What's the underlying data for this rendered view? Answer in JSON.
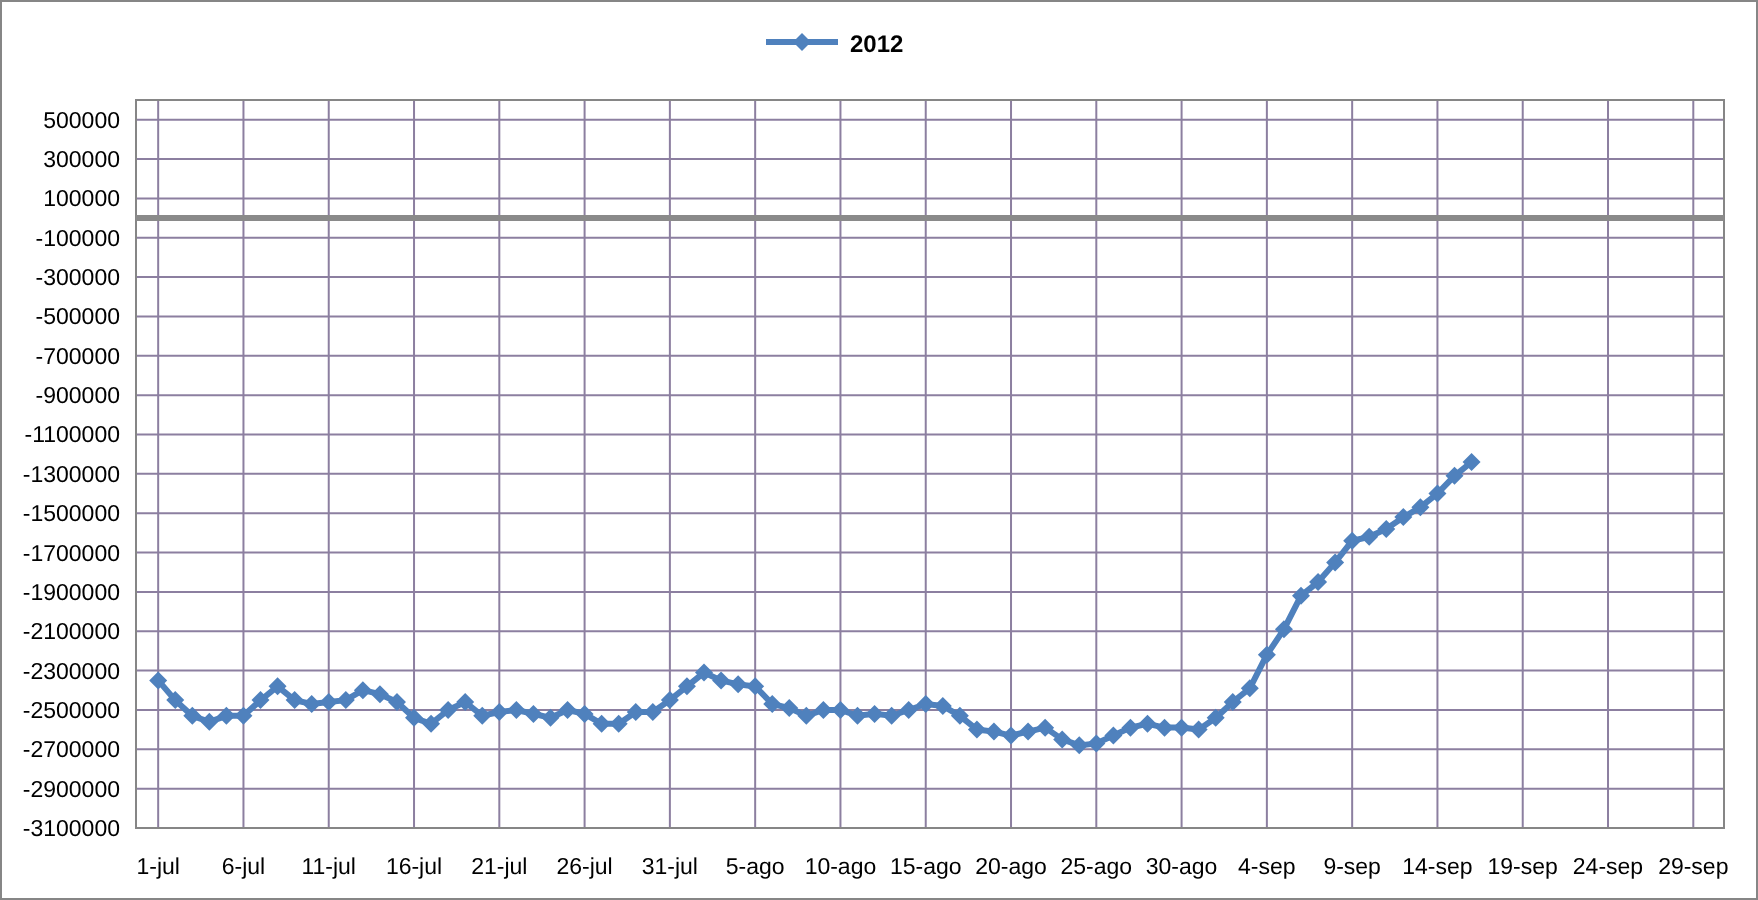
{
  "chart_data": {
    "type": "line",
    "grid": true,
    "ylim": [
      -3100000,
      600000
    ],
    "yticks": [
      500000,
      300000,
      100000,
      -100000,
      -300000,
      -500000,
      -700000,
      -900000,
      -1100000,
      -1300000,
      -1500000,
      -1700000,
      -1900000,
      -2100000,
      -2300000,
      -2500000,
      -2700000,
      -2900000,
      -3100000
    ],
    "categories": [
      "1-jul",
      null,
      null,
      null,
      null,
      "6-jul",
      null,
      null,
      null,
      null,
      "11-jul",
      null,
      null,
      null,
      null,
      "16-jul",
      null,
      null,
      null,
      null,
      "21-jul",
      null,
      null,
      null,
      null,
      "26-jul",
      null,
      null,
      null,
      null,
      "31-jul",
      null,
      null,
      null,
      null,
      "5-ago",
      null,
      null,
      null,
      null,
      "10-ago",
      null,
      null,
      null,
      null,
      "15-ago",
      null,
      null,
      null,
      null,
      "20-ago",
      null,
      null,
      null,
      null,
      "25-ago",
      null,
      null,
      null,
      null,
      "30-ago",
      null,
      null,
      null,
      null,
      "4-sep",
      null,
      null,
      null,
      null,
      "9-sep",
      null,
      null,
      null,
      null,
      "14-sep",
      null,
      null,
      null,
      null,
      "19-sep",
      null,
      null,
      null,
      null,
      "24-sep",
      null,
      null,
      null,
      null,
      "29-sep"
    ],
    "series": [
      {
        "name": "2012",
        "color": "#4f81bd",
        "marker": "diamond",
        "values": [
          -2350000,
          -2450000,
          -2530000,
          -2560000,
          -2530000,
          -2530000,
          -2450000,
          -2380000,
          -2450000,
          -2470000,
          -2460000,
          -2450000,
          -2400000,
          -2420000,
          -2460000,
          -2540000,
          -2570000,
          -2500000,
          -2460000,
          -2530000,
          -2510000,
          -2500000,
          -2520000,
          -2540000,
          -2500000,
          -2520000,
          -2570000,
          -2570000,
          -2510000,
          -2510000,
          -2450000,
          -2380000,
          -2310000,
          -2350000,
          -2370000,
          -2380000,
          -2470000,
          -2490000,
          -2530000,
          -2500000,
          -2500000,
          -2530000,
          -2520000,
          -2530000,
          -2500000,
          -2470000,
          -2480000,
          -2530000,
          -2600000,
          -2610000,
          -2630000,
          -2610000,
          -2590000,
          -2650000,
          -2680000,
          -2670000,
          -2630000,
          -2590000,
          -2570000,
          -2590000,
          -2590000,
          -2600000,
          -2540000,
          -2460000,
          -2390000,
          -2220000,
          -2090000,
          -1920000,
          -1850000,
          -1750000,
          -1640000,
          -1620000,
          -1580000,
          -1520000,
          -1470000,
          -1400000,
          -1310000,
          -1240000,
          null,
          null,
          null,
          null,
          null,
          null,
          null,
          null,
          null,
          null,
          null,
          null,
          null
        ]
      }
    ]
  }
}
